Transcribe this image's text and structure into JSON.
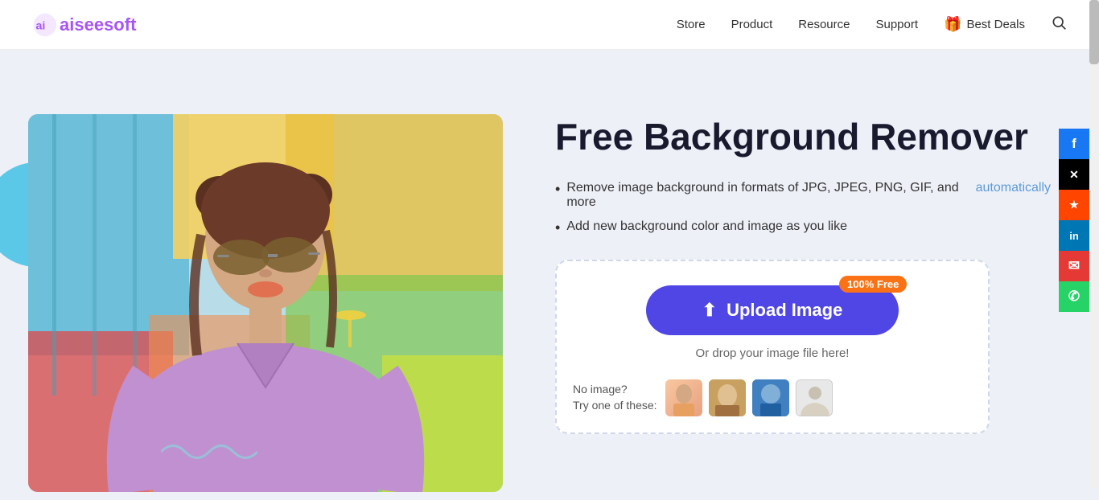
{
  "header": {
    "logo_name": "aiseesoft",
    "logo_ai": "ai",
    "logo_rest": "seesoft",
    "nav": {
      "store": "Store",
      "product": "Product",
      "resource": "Resource",
      "support": "Support",
      "best_deals": "Best Deals"
    }
  },
  "hero": {
    "title": "Free Background Remover",
    "features": [
      {
        "text": "Remove image background in formats of JPG, JPEG, PNG, GIF, and more",
        "link_text": "automatically"
      },
      {
        "text": "Add new background color and image as you like"
      }
    ],
    "upload": {
      "badge": "100% Free",
      "button_label": "Upload Image",
      "drop_text": "Or drop your image file here!",
      "no_image_label": "No image?",
      "try_label": "Try one of these:"
    }
  },
  "social": {
    "facebook": "f",
    "twitter": "𝕏",
    "reddit": "r",
    "linkedin": "in",
    "email": "✉",
    "whatsapp": "✆"
  },
  "colors": {
    "primary_purple": "#4f46e5",
    "orange_badge": "#f97316",
    "auto_link": "#5b9bd5",
    "hero_bg": "#eef0f8"
  }
}
